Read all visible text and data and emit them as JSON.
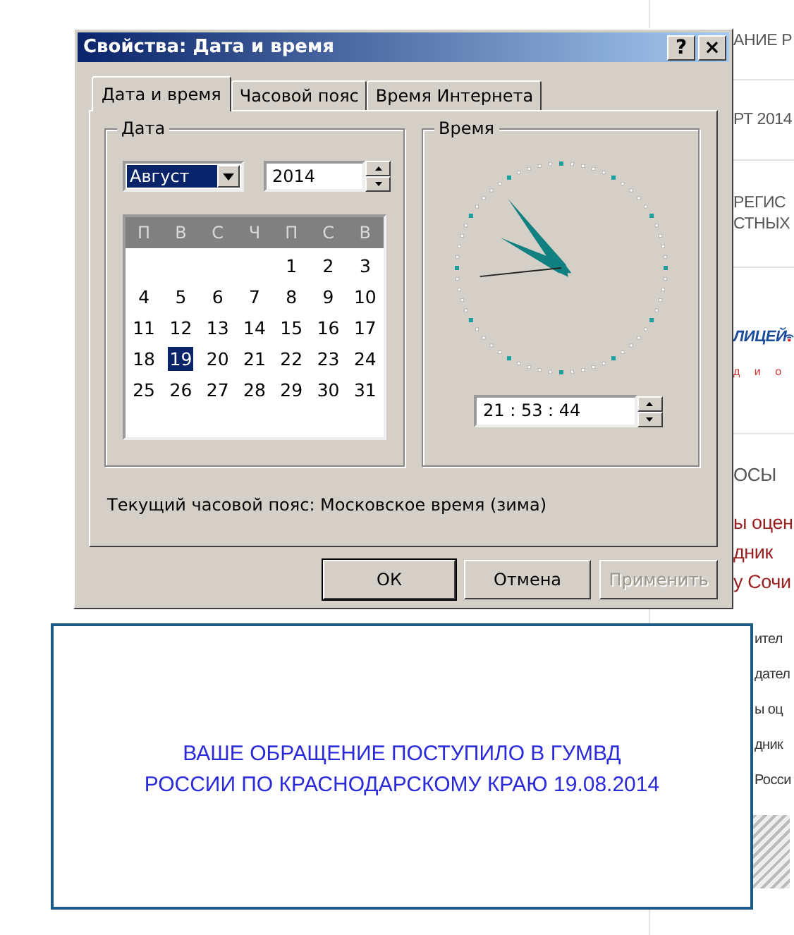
{
  "page_column": [
    {
      "kind": "heading",
      "text": "АНИЕ Р"
    },
    {
      "kind": "heading",
      "text": "РТ 2014"
    },
    {
      "kind": "heading2",
      "lines": [
        "РЕГИС",
        "СТНЫХ"
      ]
    },
    {
      "kind": "logo",
      "text": "ЛИЦЕЙ",
      "subtext": "д и о"
    },
    {
      "kind": "section",
      "text": "ОСЫ"
    },
    {
      "kind": "link",
      "text": "ы оцен"
    },
    {
      "kind": "link",
      "text": "дник"
    },
    {
      "kind": "link",
      "text": "у Сочи"
    },
    {
      "kind": "text",
      "text": "ител"
    },
    {
      "kind": "text",
      "text": "дател"
    },
    {
      "kind": "text",
      "text": "ы оц"
    },
    {
      "kind": "text",
      "text": "дник"
    },
    {
      "kind": "text",
      "text": "Росси"
    },
    {
      "kind": "photo"
    }
  ],
  "window": {
    "title": "Свойства: Дата и время",
    "help_button": "?",
    "close_button": "×"
  },
  "tabs": [
    {
      "label": "Дата и время",
      "selected": true
    },
    {
      "label": "Часовой пояс",
      "selected": false
    },
    {
      "label": "Время Интернета",
      "selected": false
    }
  ],
  "date_group": {
    "title": "Дата",
    "month": "Август",
    "year": "2014",
    "weekdays": [
      "П",
      "В",
      "С",
      "Ч",
      "П",
      "С",
      "В"
    ],
    "weeks": [
      [
        {
          "day": "1",
          "selected": false
        },
        {
          "day": "2",
          "selected": false
        },
        {
          "day": "3",
          "selected": false
        }
      ],
      [
        {
          "day": "4",
          "selected": false
        },
        {
          "day": "5",
          "selected": false
        },
        {
          "day": "6",
          "selected": false
        },
        {
          "day": "7",
          "selected": false
        },
        {
          "day": "8",
          "selected": false
        },
        {
          "day": "9",
          "selected": false
        },
        {
          "day": "10",
          "selected": false
        }
      ],
      [
        {
          "day": "11",
          "selected": false
        },
        {
          "day": "12",
          "selected": false
        },
        {
          "day": "13",
          "selected": false
        },
        {
          "day": "14",
          "selected": false
        },
        {
          "day": "15",
          "selected": false
        },
        {
          "day": "16",
          "selected": false
        },
        {
          "day": "17",
          "selected": false
        }
      ],
      [
        {
          "day": "18",
          "selected": false
        },
        {
          "day": "19",
          "selected": true
        },
        {
          "day": "20",
          "selected": false
        },
        {
          "day": "21",
          "selected": false
        },
        {
          "day": "22",
          "selected": false
        },
        {
          "day": "23",
          "selected": false
        },
        {
          "day": "24",
          "selected": false
        }
      ],
      [
        {
          "day": "25",
          "selected": false
        },
        {
          "day": "26",
          "selected": false
        },
        {
          "day": "27",
          "selected": false
        },
        {
          "day": "28",
          "selected": false
        },
        {
          "day": "29",
          "selected": false
        },
        {
          "day": "30",
          "selected": false
        },
        {
          "day": "31",
          "selected": false
        }
      ]
    ]
  },
  "time_group": {
    "title": "Время",
    "time": "21 : 53 : 44"
  },
  "timezone_text": "Текущий часовой пояс: Московское время (зима)",
  "buttons": [
    {
      "label": "ОК",
      "disabled": false,
      "default": true
    },
    {
      "label": "Отмена",
      "disabled": false,
      "default": false
    },
    {
      "label": "Применить",
      "disabled": true,
      "default": false
    }
  ],
  "notice": {
    "lines": [
      "ВАШЕ ОБРАЩЕНИЕ ПОСТУПИЛО В ГУМВД",
      "РОССИИ ПО КРАСНОДАРСКОМУ КРАЮ 19.08.2014"
    ]
  }
}
